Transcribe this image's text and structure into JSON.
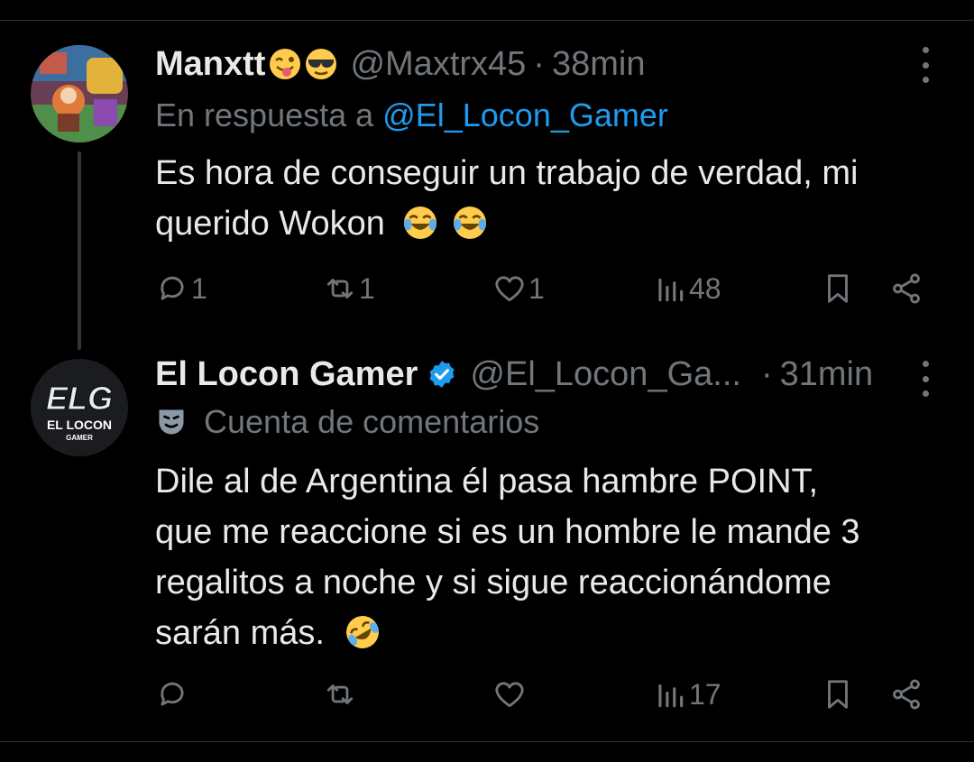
{
  "tweets": [
    {
      "name": "Manxtt",
      "handle": "@Maxtrx45",
      "dot": "·",
      "time": "38min",
      "reply_prefix": "En respuesta a",
      "reply_mention": "@El_Locon_Gamer",
      "text_line1": "Es hora de conseguir un trabajo de verdad, mi",
      "text_line2": "querido Wokon",
      "icons": [
        "winking-tongue-emoji",
        "sunglasses-emoji",
        "tears-of-joy-emoji"
      ],
      "actions": {
        "replies": "1",
        "reposts": "1",
        "likes": "1",
        "views": "48"
      }
    },
    {
      "name": "El Locon Gamer",
      "handle": "@El_Locon_Ga...",
      "dot": "·",
      "time": "31min",
      "community": "Cuenta de comentarios",
      "lines": [
        "Dile al de Argentina él pasa hambre POINT,",
        "que me reaccione si es un hombre le mande 3",
        "regalitos a noche y si sigue reaccionándome",
        "sarán más."
      ],
      "avatar_logo": "ELG",
      "avatar_caption": "EL LOCON",
      "avatar_subcaption": "GAMER",
      "icons": [
        "verified-badge-icon",
        "theater-masks-icon",
        "rolling-laughing-emoji"
      ],
      "actions": {
        "views": "17"
      }
    }
  ],
  "colors": {
    "background": "#000000",
    "text": "#e7e9ea",
    "muted": "#71767b",
    "accent": "#1d9bf0",
    "divider": "#2f3336"
  }
}
